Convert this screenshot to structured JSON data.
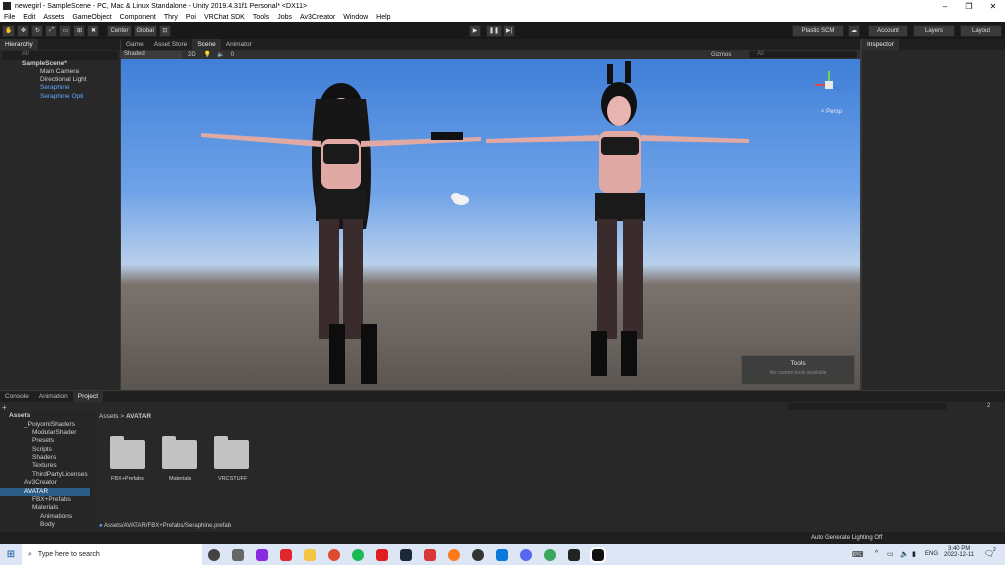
{
  "window": {
    "title": "newegirl - SampleScene - PC, Mac & Linux Standalone - Unity 2019.4.31f1 Personal* <DX11>",
    "controls": [
      "–",
      "❐",
      "✕"
    ]
  },
  "menu": [
    "File",
    "Edit",
    "Assets",
    "GameObject",
    "Component",
    "Thry",
    "Poi",
    "VRChat SDK",
    "Tools",
    "Jobs",
    "Av3Creator",
    "Window",
    "Help"
  ],
  "toolbar": {
    "center_label": "Center",
    "global_label": "Global",
    "plastic_label": "Plastic SCM",
    "account_label": "Account",
    "layers_label": "Layers",
    "layout_label": "Layout"
  },
  "hierarchy": {
    "tab": "Hierarchy",
    "search_placeholder": "All",
    "scene": "SampleScene*",
    "items": [
      "Main Camera",
      "Directional Light",
      "Seraphine",
      "Seraphine Opti"
    ]
  },
  "scene_tabs": [
    "Game",
    "Asset Store",
    "Scene",
    "Animator"
  ],
  "scene_toolbar": {
    "shading": "Shaded",
    "mode_2d": "2D",
    "fx_count": "0",
    "gizmos": "Gizmos",
    "search_placeholder": "All"
  },
  "gizmo": {
    "projection": "< Persp"
  },
  "tools_overlay": {
    "title": "Tools",
    "text": "No custom tools available"
  },
  "inspector": {
    "tab": "Inspector"
  },
  "bottom_tabs": [
    "Console",
    "Animation",
    "Project"
  ],
  "project": {
    "tree": [
      {
        "label": "Assets",
        "level": 0
      },
      {
        "label": "_PoiyomiShaders",
        "level": 1
      },
      {
        "label": "ModularShader",
        "level": 2
      },
      {
        "label": "Presets",
        "level": 2
      },
      {
        "label": "Scripts",
        "level": 2
      },
      {
        "label": "Shaders",
        "level": 2
      },
      {
        "label": "Textures",
        "level": 2
      },
      {
        "label": "ThirdPartyLicenses",
        "level": 2
      },
      {
        "label": "Av3Creator",
        "level": 1
      },
      {
        "label": "AVATAR",
        "level": 1
      },
      {
        "label": "FBX+Prefabs",
        "level": 2
      },
      {
        "label": "Materials",
        "level": 2
      },
      {
        "label": "Animations",
        "level": 3
      },
      {
        "label": "Body",
        "level": 3
      }
    ],
    "breadcrumb": [
      "Assets",
      "AVATAR"
    ],
    "folders": [
      "FBX+Prefabs",
      "Materials",
      "VRCSTUFF"
    ],
    "selected_path": "Assets/AVATAR/FBX+Prefabs/Seraphine.prefab",
    "badge_count": "2"
  },
  "status": {
    "lighting": "Auto Generate Lighting Off"
  },
  "taskbar": {
    "search_placeholder": "Type here to search",
    "language": "ENG",
    "time": "3:40 PM",
    "date": "2022-12-11",
    "notification_count": "2",
    "apps": [
      "task-view",
      "taskmgr",
      "twitch",
      "brave",
      "explorer",
      "chrome",
      "spotify",
      "youtube",
      "steam",
      "defender",
      "firefox",
      "obs",
      "mail",
      "discord",
      "discord-ptb",
      "unity",
      "vscode"
    ]
  },
  "colors": {
    "unity_dark": "#282828",
    "selection": "#2c5d87",
    "sky": "#6fa3e8"
  }
}
